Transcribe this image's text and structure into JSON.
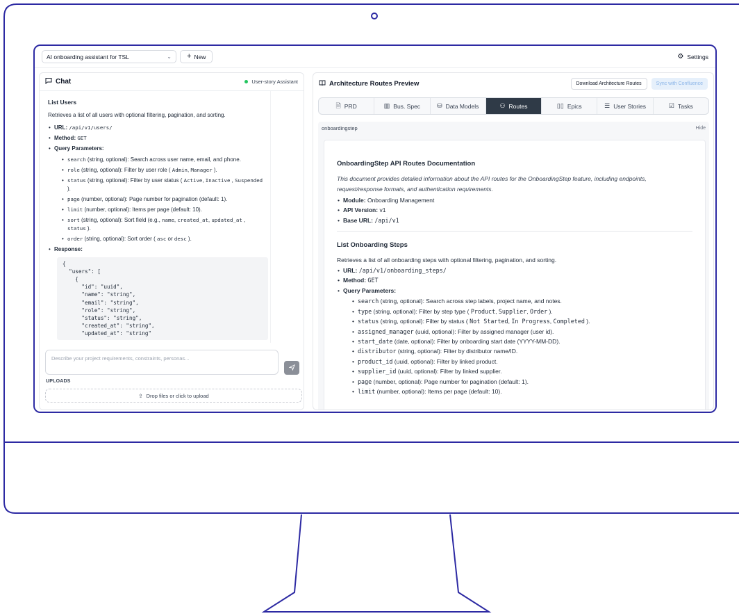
{
  "colors": {
    "frame": "#2d2aa3",
    "active_tab": "#2f3a47",
    "status_dot": "#22c55e",
    "sync_bg": "#e6f0fb"
  },
  "topbar": {
    "project_select": "AI onboarding assistant for TSL",
    "new_button": "New",
    "settings": "Settings"
  },
  "chat": {
    "title": "Chat",
    "badge": "User-story Assistant",
    "section_title": "List Users",
    "intro": "Retrieves a list of all users with optional filtering, pagination, and sorting.",
    "url_label": "URL:",
    "url_value": "/api/v1/users/",
    "method_label": "Method:",
    "method_value": "GET",
    "query_label": "Query Parameters:",
    "params": [
      {
        "name": "search",
        "pre": " (string, optional): Search across user name, email, and phone.",
        "codes": [],
        "mid": [],
        "post": ""
      },
      {
        "name": "role",
        "pre": " (string, optional): Filter by user role ( ",
        "codes": [
          "Admin",
          "Manager"
        ],
        "mid": [
          ", "
        ],
        "post": " )."
      },
      {
        "name": "status",
        "pre": " (string, optional): Filter by user status ( ",
        "codes": [
          "Active",
          "Inactive",
          "Suspended"
        ],
        "mid": [
          ", ",
          " , "
        ],
        "post": " )."
      },
      {
        "name": "page",
        "pre": " (number, optional): Page number for pagination (default: 1).",
        "codes": [],
        "mid": [],
        "post": ""
      },
      {
        "name": "limit",
        "pre": " (number, optional): Items per page (default: 10).",
        "codes": [],
        "mid": [],
        "post": ""
      },
      {
        "name": "sort",
        "pre": " (string, optional): Sort field (e.g., ",
        "codes": [
          "name",
          "created_at",
          "updated_at",
          "status"
        ],
        "mid": [
          ", ",
          ", ",
          " , "
        ],
        "post": " )."
      },
      {
        "name": "order",
        "pre": " (string, optional): Sort order ( ",
        "codes": [
          "asc",
          "desc"
        ],
        "mid": [
          " or "
        ],
        "post": " )."
      }
    ],
    "response_label": "Response:",
    "response_code": "{\n  \"users\": [\n    {\n      \"id\": \"uuid\",\n      \"name\": \"string\",\n      \"email\": \"string\",\n      \"role\": \"string\",\n      \"status\": \"string\",\n      \"created_at\": \"string\",\n      \"updated_at\": \"string\"",
    "input_placeholder": "Describe your project requirements, constraints, personas...",
    "uploads_label": "UPLOADS",
    "dropzone": "Drop files or click to upload"
  },
  "arch": {
    "title": "Architecture Routes Preview",
    "download_button": "Download Architecture Routes",
    "sync_button": "Sync with Confluence",
    "tabs": [
      {
        "label": "PRD",
        "icon": "document-icon",
        "active": false
      },
      {
        "label": "Bus. Spec",
        "icon": "building-icon",
        "active": false
      },
      {
        "label": "Data Models",
        "icon": "database-icon",
        "active": false
      },
      {
        "label": "Routes",
        "icon": "routes-icon",
        "active": true
      },
      {
        "label": "Epics",
        "icon": "book-icon",
        "active": false
      },
      {
        "label": "User Stories",
        "icon": "list-icon",
        "active": false
      },
      {
        "label": "Tasks",
        "icon": "checkbox-icon",
        "active": false
      }
    ],
    "file_name": "onboardingstep",
    "hide_button": "Hide",
    "doc": {
      "title": "OnboardingStep API Routes Documentation",
      "intro": "This document provides detailed information about the API routes for the OnboardingStep feature, including endpoints, request/response formats, and authentication requirements.",
      "module_label": "Module:",
      "module_value": "Onboarding Management",
      "version_label": "API Version:",
      "version_value": "v1",
      "base_label": "Base URL:",
      "base_value": "/api/v1",
      "section_title": "List Onboarding Steps",
      "section_intro": "Retrieves a list of all onboarding steps with optional filtering, pagination, and sorting.",
      "url_label": "URL:",
      "url_value": "/api/v1/onboarding_steps/",
      "method_label": "Method:",
      "method_value": "GET",
      "query_label": "Query Parameters:",
      "params": [
        {
          "name": "search",
          "pre": " (string, optional): Search across step labels, project name, and notes.",
          "codes": [],
          "mid": [],
          "post": ""
        },
        {
          "name": "type",
          "pre": " (string, optional): Filter by step type ( ",
          "codes": [
            "Product",
            "Supplier",
            "Order"
          ],
          "mid": [
            ", ",
            ", "
          ],
          "post": " )."
        },
        {
          "name": "status",
          "pre": " (string, optional): Filter by status ( ",
          "codes": [
            "Not Started",
            "In Progress",
            "Completed"
          ],
          "mid": [
            ", ",
            ", "
          ],
          "post": " )."
        },
        {
          "name": "assigned_manager",
          "pre": " (uuid, optional): Filter by assigned manager (user id).",
          "codes": [],
          "mid": [],
          "post": ""
        },
        {
          "name": "start_date",
          "pre": " (date, optional): Filter by onboarding start date (YYYY-MM-DD).",
          "codes": [],
          "mid": [],
          "post": ""
        },
        {
          "name": "distributor",
          "pre": " (string, optional): Filter by distributor name/ID.",
          "codes": [],
          "mid": [],
          "post": ""
        },
        {
          "name": "product_id",
          "pre": " (uuid, optional): Filter by linked product.",
          "codes": [],
          "mid": [],
          "post": ""
        },
        {
          "name": "supplier_id",
          "pre": " (uuid, optional): Filter by linked supplier.",
          "codes": [],
          "mid": [],
          "post": ""
        },
        {
          "name": "page",
          "pre": " (number, optional): Page number for pagination (default: 1).",
          "codes": [],
          "mid": [],
          "post": ""
        },
        {
          "name": "limit",
          "pre": " (number, optional): Items per page (default: 10).",
          "codes": [],
          "mid": [],
          "post": ""
        }
      ]
    }
  }
}
